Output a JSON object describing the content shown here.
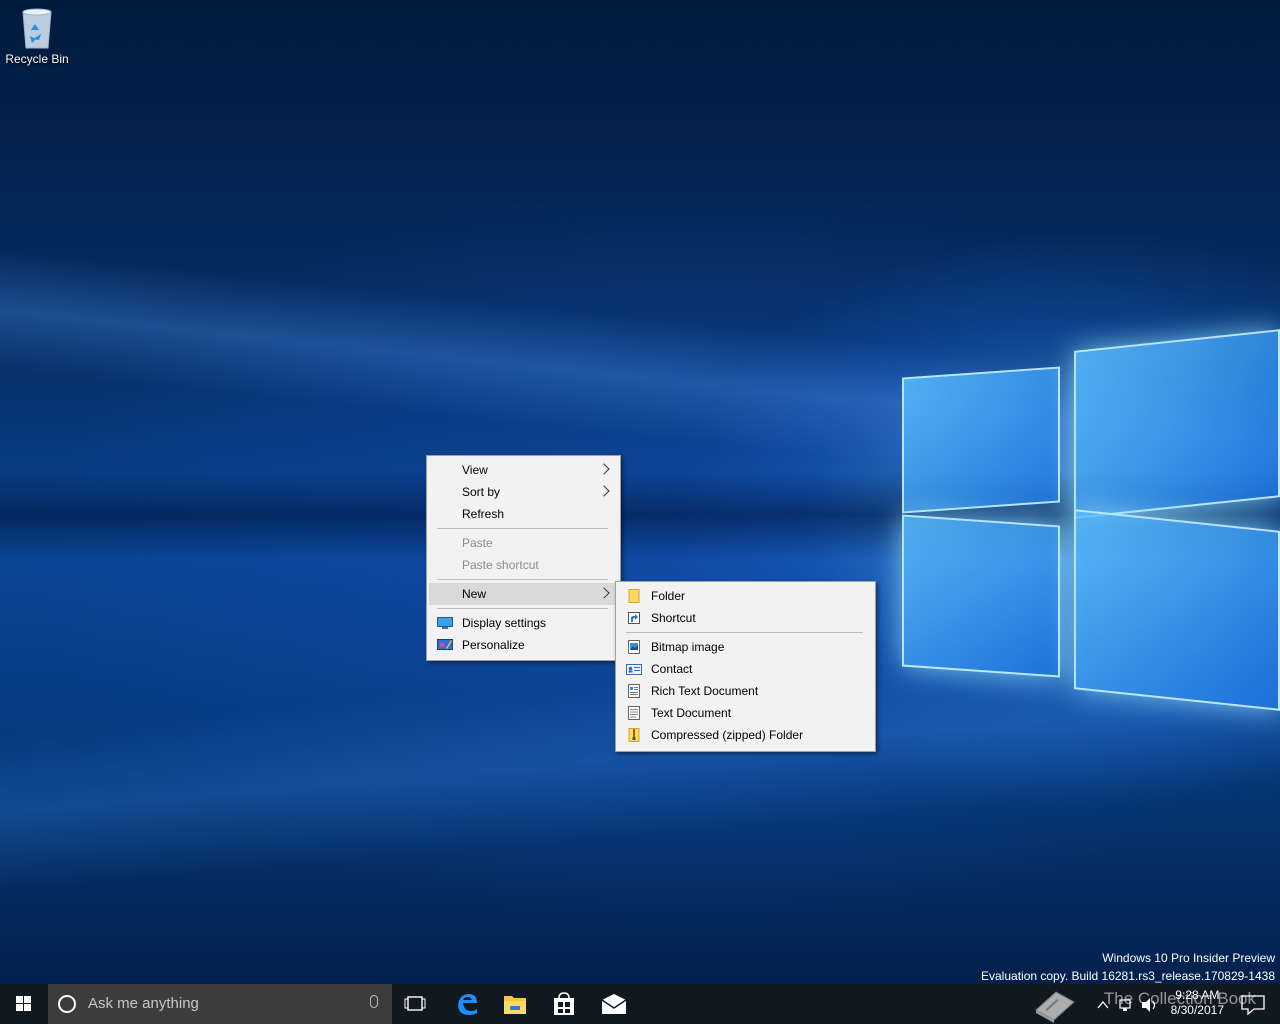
{
  "desktop": {
    "icons": [
      {
        "label": "Recycle Bin",
        "icon": "recycle-bin-icon"
      }
    ],
    "watermark": {
      "line1": "Windows 10 Pro Insider Preview",
      "line2": "Evaluation copy. Build 16281.rs3_release.170829-1438"
    }
  },
  "context_menu": {
    "items": [
      {
        "label": "View",
        "submenu": true
      },
      {
        "label": "Sort by",
        "submenu": true
      },
      {
        "label": "Refresh"
      },
      {
        "label": "Paste",
        "disabled": true
      },
      {
        "label": "Paste shortcut",
        "disabled": true
      },
      {
        "label": "New",
        "submenu": true,
        "highlighted": true
      },
      {
        "label": "Display settings",
        "icon": "display-icon"
      },
      {
        "label": "Personalize",
        "icon": "personalize-icon"
      }
    ]
  },
  "new_submenu": {
    "items": [
      {
        "label": "Folder",
        "icon": "folder-icon"
      },
      {
        "label": "Shortcut",
        "icon": "shortcut-icon"
      },
      {
        "label": "Bitmap image",
        "icon": "bitmap-icon"
      },
      {
        "label": "Contact",
        "icon": "contact-icon"
      },
      {
        "label": "Rich Text Document",
        "icon": "rich-text-icon"
      },
      {
        "label": "Text Document",
        "icon": "text-document-icon"
      },
      {
        "label": "Compressed (zipped) Folder",
        "icon": "zip-folder-icon"
      }
    ]
  },
  "taskbar": {
    "search_placeholder": "Ask me anything",
    "pinned": [
      "task-view-icon",
      "edge-icon",
      "file-explorer-icon",
      "store-icon",
      "mail-icon"
    ],
    "clock": {
      "time": "9:28 AM",
      "date": "8/30/2017"
    },
    "overlay_text": "The Collection Book"
  },
  "colors": {
    "menu_bg": "#f2f2f2",
    "menu_hot": "#d9d9d9",
    "taskbar_bg": "#101820",
    "search_bg": "#3c3c3c"
  }
}
